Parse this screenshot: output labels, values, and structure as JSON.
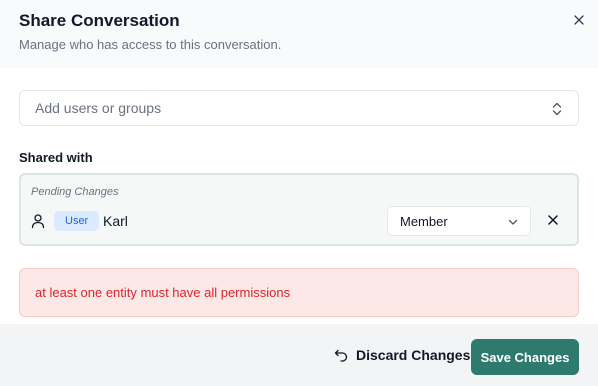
{
  "dialog": {
    "title": "Share Conversation",
    "subtitle": "Manage who has access to this conversation."
  },
  "add_input": {
    "placeholder": "Add users or groups"
  },
  "shared_with": {
    "label": "Shared with",
    "pending": {
      "title": "Pending Changes",
      "entry": {
        "icon": "person-icon",
        "type_badge": "User",
        "name": "Karl",
        "role": "Member"
      }
    }
  },
  "error": {
    "message": "at least one entity must have all permissions"
  },
  "footer": {
    "discard_label": "Discard Changes",
    "save_label": "Save Changes"
  },
  "colors": {
    "accent": "#2f7a6f",
    "error_bg": "#fde8e8",
    "error_text": "#dc2626",
    "badge_bg": "#dbeafe",
    "badge_text": "#2563eb"
  }
}
